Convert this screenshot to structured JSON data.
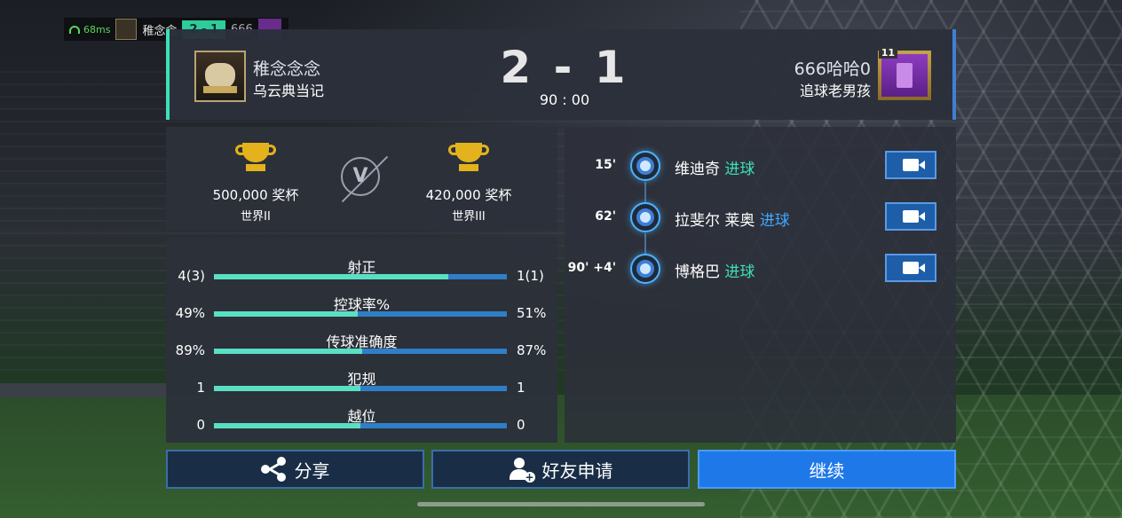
{
  "topbar": {
    "ping": "68ms",
    "home_name": "稚念念",
    "score": "2 - 1",
    "away_name": "666"
  },
  "header": {
    "home_name": "稚念念念",
    "home_club": "乌云典当记",
    "score": "2 - 1",
    "time": "90 : 00",
    "away_name": "666哈哈0",
    "away_club": "追球老男孩",
    "away_level": "11"
  },
  "trophies": {
    "home": {
      "value": "500,000 奖杯",
      "division": "世界II"
    },
    "away": {
      "value": "420,000 奖杯",
      "division": "世界III"
    },
    "vs_label": "V"
  },
  "stats": [
    {
      "label": "射正",
      "home": "4(3)",
      "away": "1(1)",
      "home_share": 0.8
    },
    {
      "label": "控球率%",
      "home": "49%",
      "away": "51%",
      "home_share": 0.49
    },
    {
      "label": "传球准确度",
      "home": "89%",
      "away": "87%",
      "home_share": 0.506
    },
    {
      "label": "犯规",
      "home": "1",
      "away": "1",
      "home_share": 0.5
    },
    {
      "label": "越位",
      "home": "0",
      "away": "0",
      "home_share": 0.5
    }
  ],
  "events": [
    {
      "minute": "15'",
      "player": "维迪奇",
      "type": "进球",
      "type_color": "#3ee0b8"
    },
    {
      "minute": "62'",
      "player": "拉斐尔 莱奥",
      "type": "进球",
      "type_color": "#3fa7ff"
    },
    {
      "minute": "90' +4'",
      "player": "博格巴",
      "type": "进球",
      "type_color": "#3ee0b8"
    }
  ],
  "buttons": {
    "share": "分享",
    "friend": "好友申请",
    "continue": "继续"
  },
  "colors": {
    "home_accent": "#3ee0b8",
    "away_accent": "#3f7fd6",
    "primary_button": "#1e78e8"
  }
}
